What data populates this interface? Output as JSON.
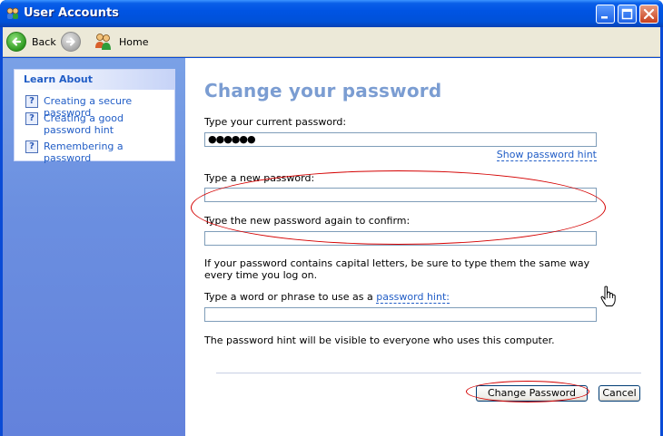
{
  "window": {
    "title": "User Accounts"
  },
  "toolbar": {
    "back_label": "Back",
    "home_label": "Home"
  },
  "sidebar": {
    "heading": "Learn About",
    "items": [
      {
        "label": "Creating a secure password"
      },
      {
        "label": "Creating a good password hint"
      },
      {
        "label": "Remembering a password"
      }
    ]
  },
  "form": {
    "title": "Change your password",
    "current_label": "Type your current password:",
    "current_value": "●●●●●●",
    "show_hint_link": "Show password hint",
    "new_label": "Type a new password:",
    "new_value": "",
    "confirm_label": "Type the new password again to confirm:",
    "confirm_value": "",
    "caps_note": "If your password contains capital letters, be sure to type them the same way every time you log on.",
    "hint_label_prefix": "Type a word or phrase to use as a ",
    "hint_label_link": "password hint:",
    "hint_value": "",
    "hint_note": "The password hint will be visible to everyone who uses this computer."
  },
  "buttons": {
    "change_password": "Change Password",
    "cancel": "Cancel"
  },
  "colors": {
    "titlebar": "#0054e3",
    "sidebar": "#6b8fe0",
    "link": "#215dc6",
    "heading": "#7b9dd2",
    "annotation": "#d40000"
  },
  "icons": {
    "title": "user-accounts-icon",
    "back": "back-arrow-icon",
    "forward": "forward-arrow-icon",
    "home": "home-users-icon",
    "help": "help-question-icon",
    "cursor": "hand-pointer-icon"
  }
}
